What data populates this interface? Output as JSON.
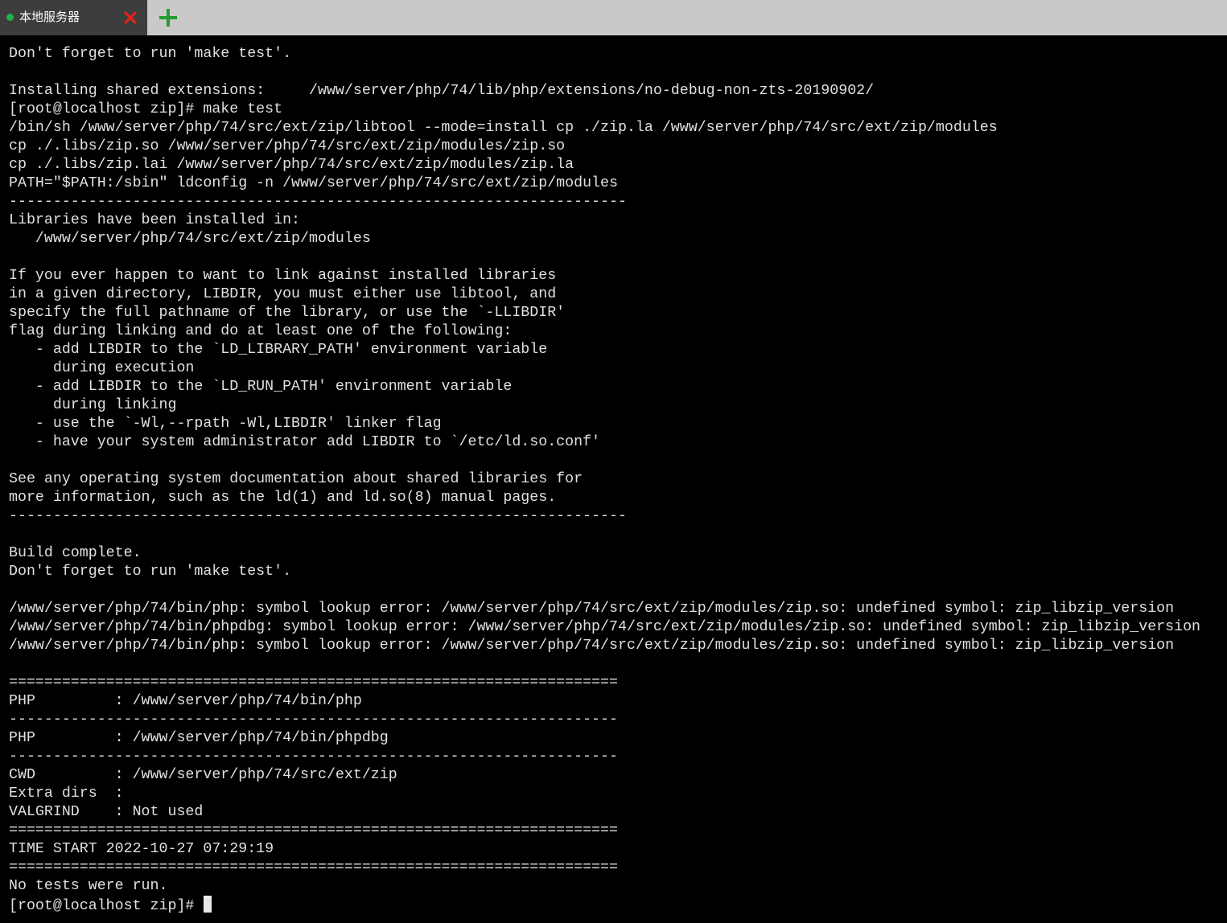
{
  "tabs": [
    {
      "label": "本地服务器",
      "status_color": "#22b14c",
      "active": true
    }
  ],
  "icons": {
    "status": "status-dot-icon",
    "close": "close-x-icon",
    "add": "plus-icon"
  },
  "colors": {
    "close_icon": "#e0231b",
    "add_icon": "#1f9e2e",
    "terminal_bg": "#000000",
    "terminal_fg": "#e0e0e0"
  },
  "terminal": {
    "lines": [
      "Don't forget to run 'make test'.",
      "",
      "Installing shared extensions:     /www/server/php/74/lib/php/extensions/no-debug-non-zts-20190902/",
      "[root@localhost zip]# make test",
      "/bin/sh /www/server/php/74/src/ext/zip/libtool --mode=install cp ./zip.la /www/server/php/74/src/ext/zip/modules",
      "cp ./.libs/zip.so /www/server/php/74/src/ext/zip/modules/zip.so",
      "cp ./.libs/zip.lai /www/server/php/74/src/ext/zip/modules/zip.la",
      "PATH=\"$PATH:/sbin\" ldconfig -n /www/server/php/74/src/ext/zip/modules",
      "----------------------------------------------------------------------",
      "Libraries have been installed in:",
      "   /www/server/php/74/src/ext/zip/modules",
      "",
      "If you ever happen to want to link against installed libraries",
      "in a given directory, LIBDIR, you must either use libtool, and",
      "specify the full pathname of the library, or use the `-LLIBDIR'",
      "flag during linking and do at least one of the following:",
      "   - add LIBDIR to the `LD_LIBRARY_PATH' environment variable",
      "     during execution",
      "   - add LIBDIR to the `LD_RUN_PATH' environment variable",
      "     during linking",
      "   - use the `-Wl,--rpath -Wl,LIBDIR' linker flag",
      "   - have your system administrator add LIBDIR to `/etc/ld.so.conf'",
      "",
      "See any operating system documentation about shared libraries for",
      "more information, such as the ld(1) and ld.so(8) manual pages.",
      "----------------------------------------------------------------------",
      "",
      "Build complete.",
      "Don't forget to run 'make test'.",
      "",
      "/www/server/php/74/bin/php: symbol lookup error: /www/server/php/74/src/ext/zip/modules/zip.so: undefined symbol: zip_libzip_version",
      "/www/server/php/74/bin/phpdbg: symbol lookup error: /www/server/php/74/src/ext/zip/modules/zip.so: undefined symbol: zip_libzip_version",
      "/www/server/php/74/bin/php: symbol lookup error: /www/server/php/74/src/ext/zip/modules/zip.so: undefined symbol: zip_libzip_version",
      "",
      "=====================================================================",
      "PHP         : /www/server/php/74/bin/php",
      "---------------------------------------------------------------------",
      "PHP         : /www/server/php/74/bin/phpdbg",
      "---------------------------------------------------------------------",
      "CWD         : /www/server/php/74/src/ext/zip",
      "Extra dirs  :",
      "VALGRIND    : Not used",
      "=====================================================================",
      "TIME START 2022-10-27 07:29:19",
      "=====================================================================",
      "No tests were run.",
      "[root@localhost zip]# "
    ]
  }
}
